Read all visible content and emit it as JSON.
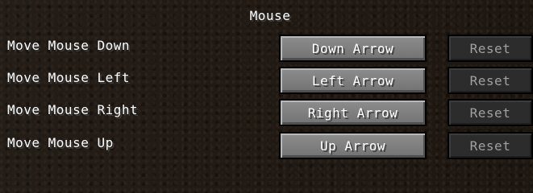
{
  "section_title": "Mouse",
  "colors": {
    "background": "#1f1812",
    "button_face": "#7f7f7f",
    "button_disabled": "#2c2c2c",
    "text": "#ffffff",
    "text_disabled": "#a0a0a0"
  },
  "bindings": [
    {
      "action": "Move Mouse Down",
      "key": "Down Arrow",
      "reset_label": "Reset",
      "reset_enabled": false
    },
    {
      "action": "Move Mouse Left",
      "key": "Left Arrow",
      "reset_label": "Reset",
      "reset_enabled": false
    },
    {
      "action": "Move Mouse Right",
      "key": "Right Arrow",
      "reset_label": "Reset",
      "reset_enabled": false
    },
    {
      "action": "Move Mouse Up",
      "key": "Up Arrow",
      "reset_label": "Reset",
      "reset_enabled": false
    }
  ]
}
